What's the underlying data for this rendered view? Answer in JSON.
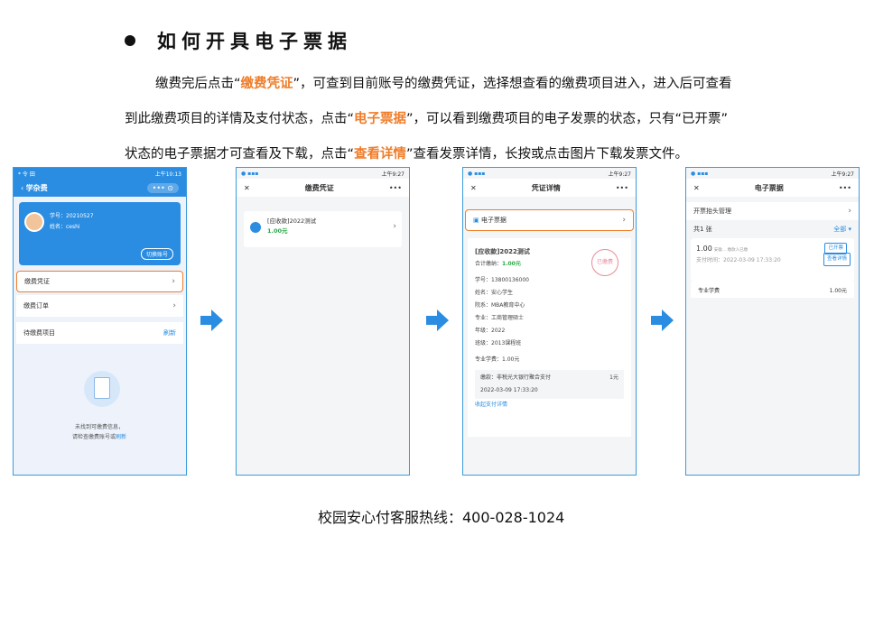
{
  "heading": {
    "title": "如何开具电子票据"
  },
  "paragraph": {
    "line1": [
      "缴费完后点击“",
      "缴费凭证",
      "”，可查到目前账号的缴费凭证，选择想查看的缴费项目进入，进入后可查看"
    ],
    "line2": [
      "到此缴费项目的详情及支付状态，点击“",
      "电子票据",
      "”，可以看到缴费项目的电子发票的状态，只有“已开票”"
    ],
    "line3": [
      "状态的电子票据才可查看及下载，点击“",
      "查看详情",
      "”查看发票详情，长按或点击图片下载发票文件。"
    ]
  },
  "footer": {
    "hotline": "校园安心付客服热线：400-028-1024"
  },
  "phone1": {
    "status_left": "* 令 田",
    "status_time": "上午10:13",
    "nav_title": "学杂费",
    "student_id": "学号：20210527",
    "student_name": "姓名：ceshi",
    "switch_account": "切换账号",
    "menu": [
      "缴费凭证",
      "缴费订单",
      "待缴费项目"
    ],
    "refresh": "刷新",
    "empty_line1": "未找到可缴费信息，",
    "empty_line2": "请检查缴费账号或",
    "empty_link": "刷新"
  },
  "phone2": {
    "status_time": "上午9:27",
    "nav_title": "缴费凭证",
    "bill_title": "[应收款]2022测试",
    "bill_amount": "1.00元"
  },
  "phone3": {
    "status_time": "上午9:27",
    "nav_title": "凭证详情",
    "e_invoice": "电子票据",
    "bill_title": "[应收款]2022测试",
    "total_label": "合计缴纳：",
    "total_value": "1.00元",
    "seal_text": "已缴费",
    "fields": [
      "学号：13800136000",
      "姓名：安心学生",
      "院系：MBA教育中心",
      "专业：工商管理硕士",
      "年级：2022",
      "班级：2013课程班"
    ],
    "tuition": "专业学费：1.00元",
    "pay_channel": "缴款：非税光大银行聚合支付",
    "pay_count": "1元",
    "pay_time": "2022-03-09 17:33:20",
    "collapse": "收起支付详情"
  },
  "phone4": {
    "status_time": "上午9:27",
    "nav_title": "电子票据",
    "header_mgmt": "开票抬头管理",
    "count": "共1 张",
    "filter": "全部",
    "amount": "1.00",
    "amount_sub": "安徽… 缴款人已缴",
    "status_tag": "已开票",
    "pay_time": "支付时间：2022-03-09 17:33:20",
    "view_detail": "查看详情",
    "item_name": "专业学费",
    "item_amount": "1.00元"
  }
}
